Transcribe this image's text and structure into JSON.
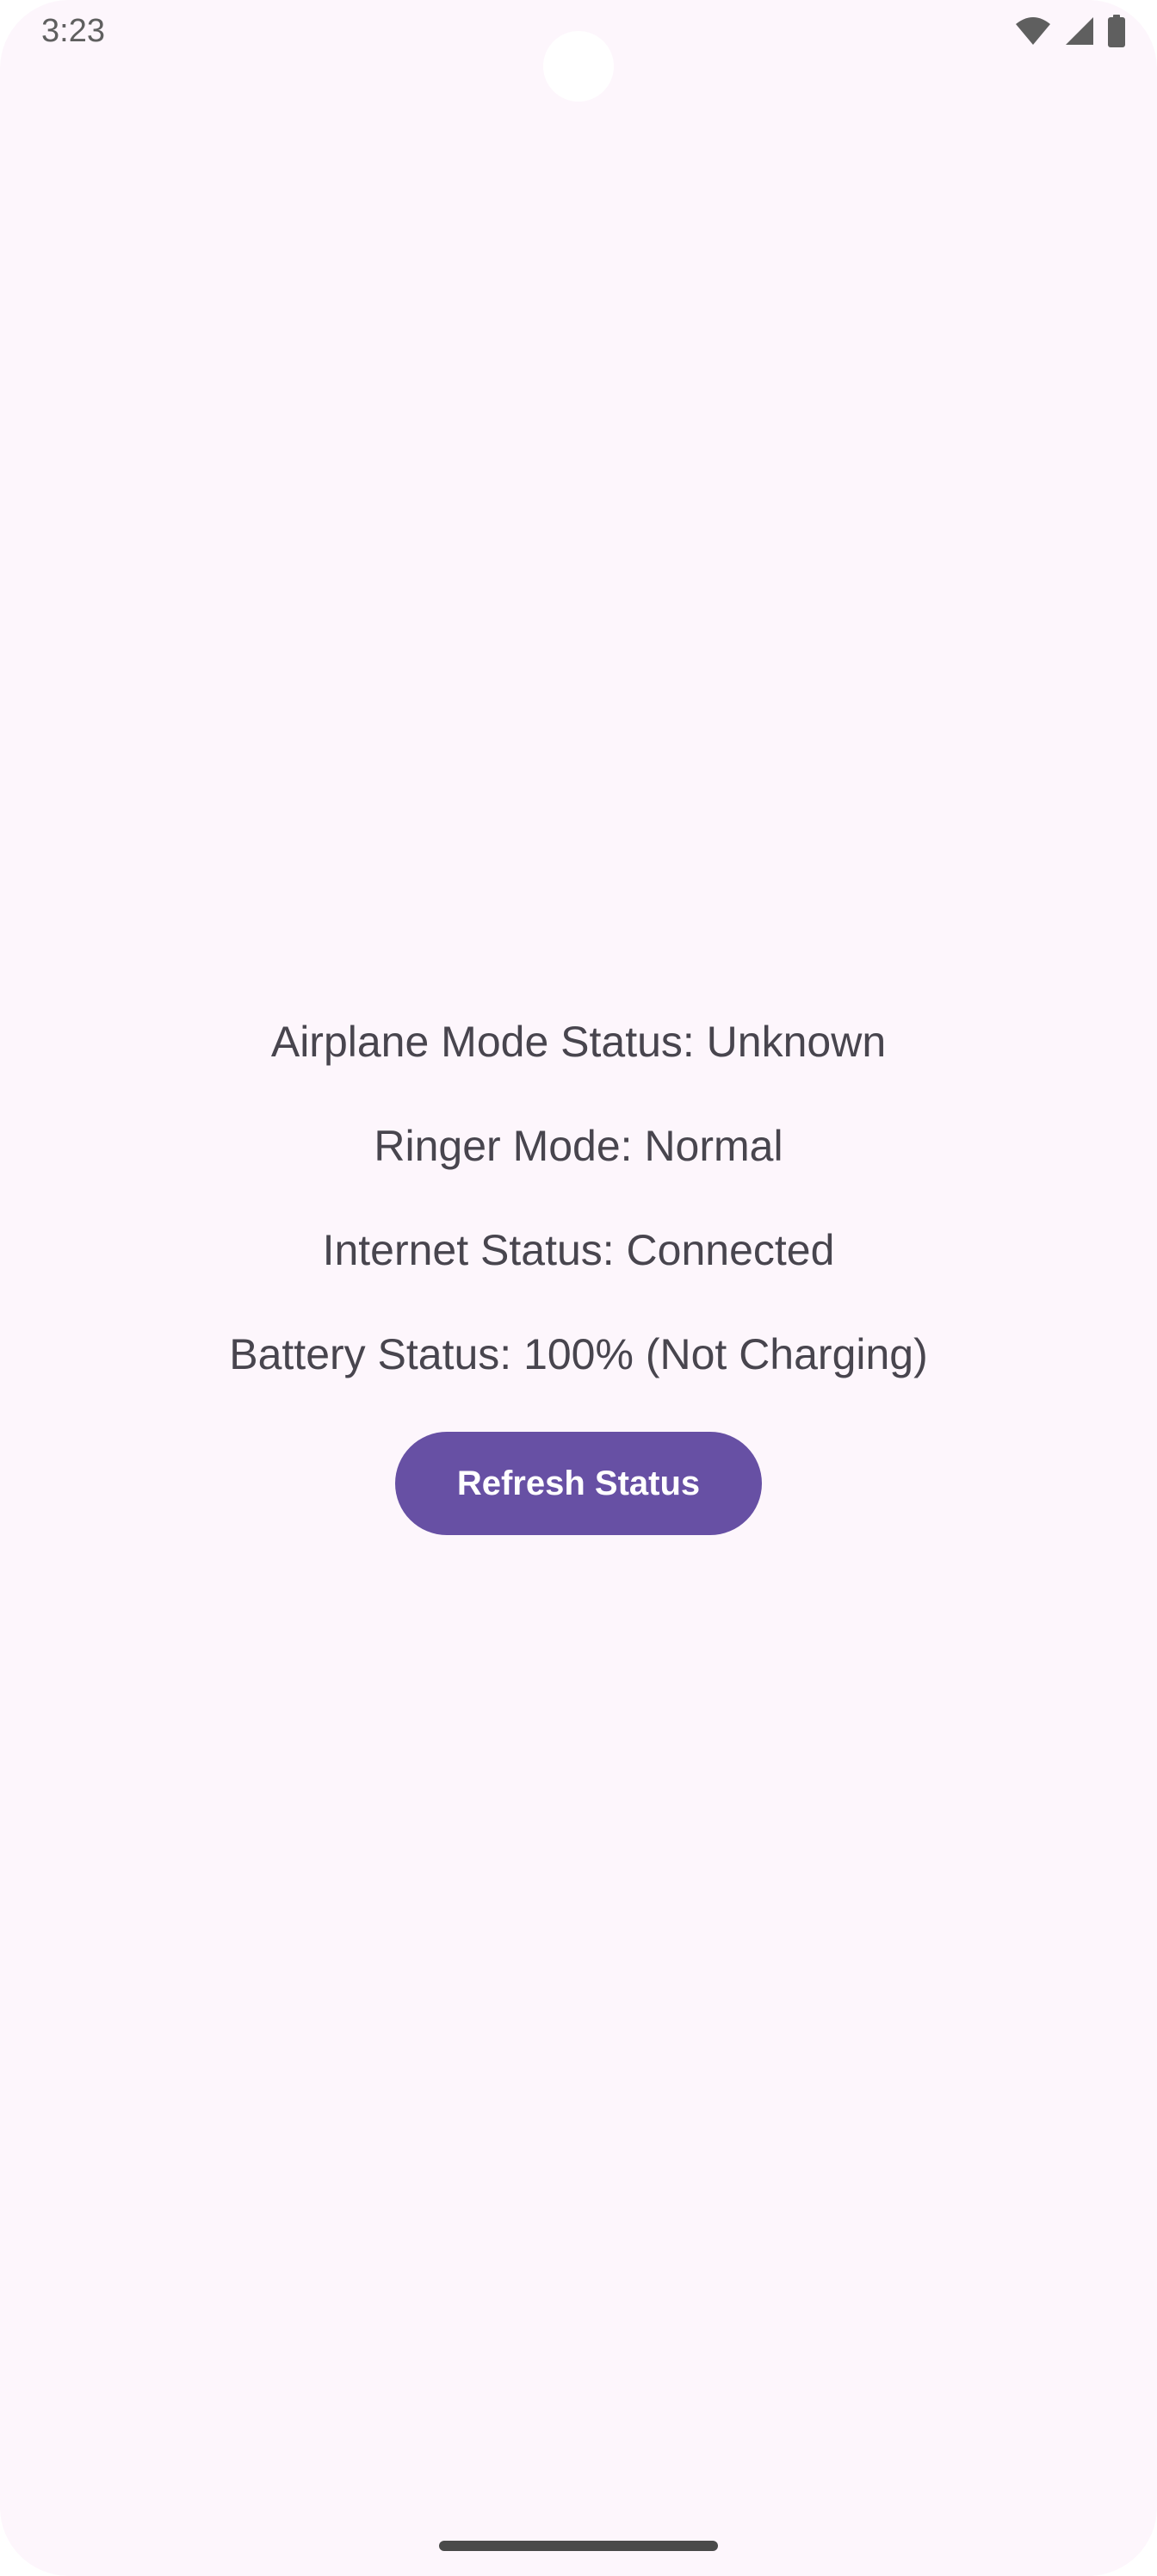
{
  "status_bar": {
    "time": "3:23",
    "icons": [
      "wifi-icon",
      "cellular-signal-icon",
      "battery-icon"
    ]
  },
  "statuses": {
    "airplane_mode": "Airplane Mode Status: Unknown",
    "ringer_mode": "Ringer Mode: Normal",
    "internet": "Internet Status: Connected",
    "battery": "Battery Status: 100% (Not Charging)"
  },
  "actions": {
    "refresh_label": "Refresh Status"
  },
  "colors": {
    "background": "#fdf6fc",
    "primary": "#6750a4",
    "text": "#48454e"
  }
}
